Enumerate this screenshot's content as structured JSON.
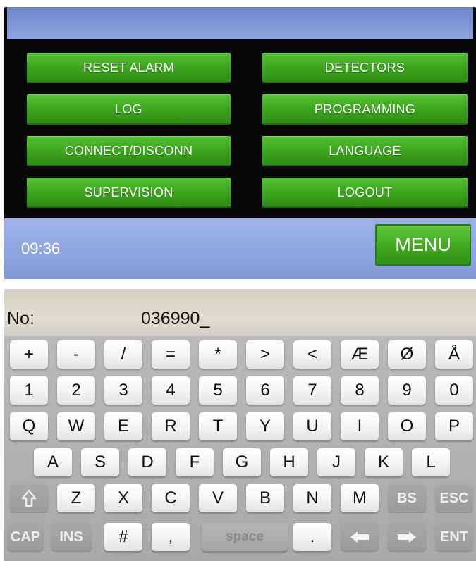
{
  "menu_screen": {
    "left_buttons": [
      "RESET ALARM",
      "LOG",
      "CONNECT/DISCONN",
      "SUPERVISION"
    ],
    "right_buttons": [
      "DETECTORS",
      "PROGRAMMING",
      "LANGUAGE",
      "LOGOUT"
    ],
    "time": "09:36",
    "menu_label": "MENU"
  },
  "entry": {
    "label": "No:",
    "value": "036990_"
  },
  "keyboard": {
    "row1": [
      "+",
      "-",
      "/",
      "=",
      "*",
      ">",
      "<",
      "Æ",
      "Ø",
      "Å"
    ],
    "row2": [
      "1",
      "2",
      "3",
      "4",
      "5",
      "6",
      "7",
      "8",
      "9",
      "0"
    ],
    "row3": [
      "Q",
      "W",
      "E",
      "R",
      "T",
      "Y",
      "U",
      "I",
      "O",
      "P"
    ],
    "row4": [
      "A",
      "S",
      "D",
      "F",
      "G",
      "H",
      "J",
      "K",
      "L"
    ],
    "row5": {
      "shift_icon": "shift-up-arrow-icon",
      "letters": [
        "Z",
        "X",
        "C",
        "V",
        "B",
        "N",
        "M"
      ],
      "bs": "BS",
      "esc": "ESC"
    },
    "row6": {
      "cap": "CAP",
      "ins": "INS",
      "hash": "#",
      "comma": ",",
      "space": "space",
      "dot": ".",
      "left_icon": "left-arrow-icon",
      "right_icon": "right-arrow-icon",
      "ent": "ENT"
    }
  },
  "colors": {
    "menu_green": "#3aa21c",
    "status_blue": "#8ea4e0",
    "key_light": "#f2f2f2",
    "key_dark": "#9a9a9a"
  }
}
